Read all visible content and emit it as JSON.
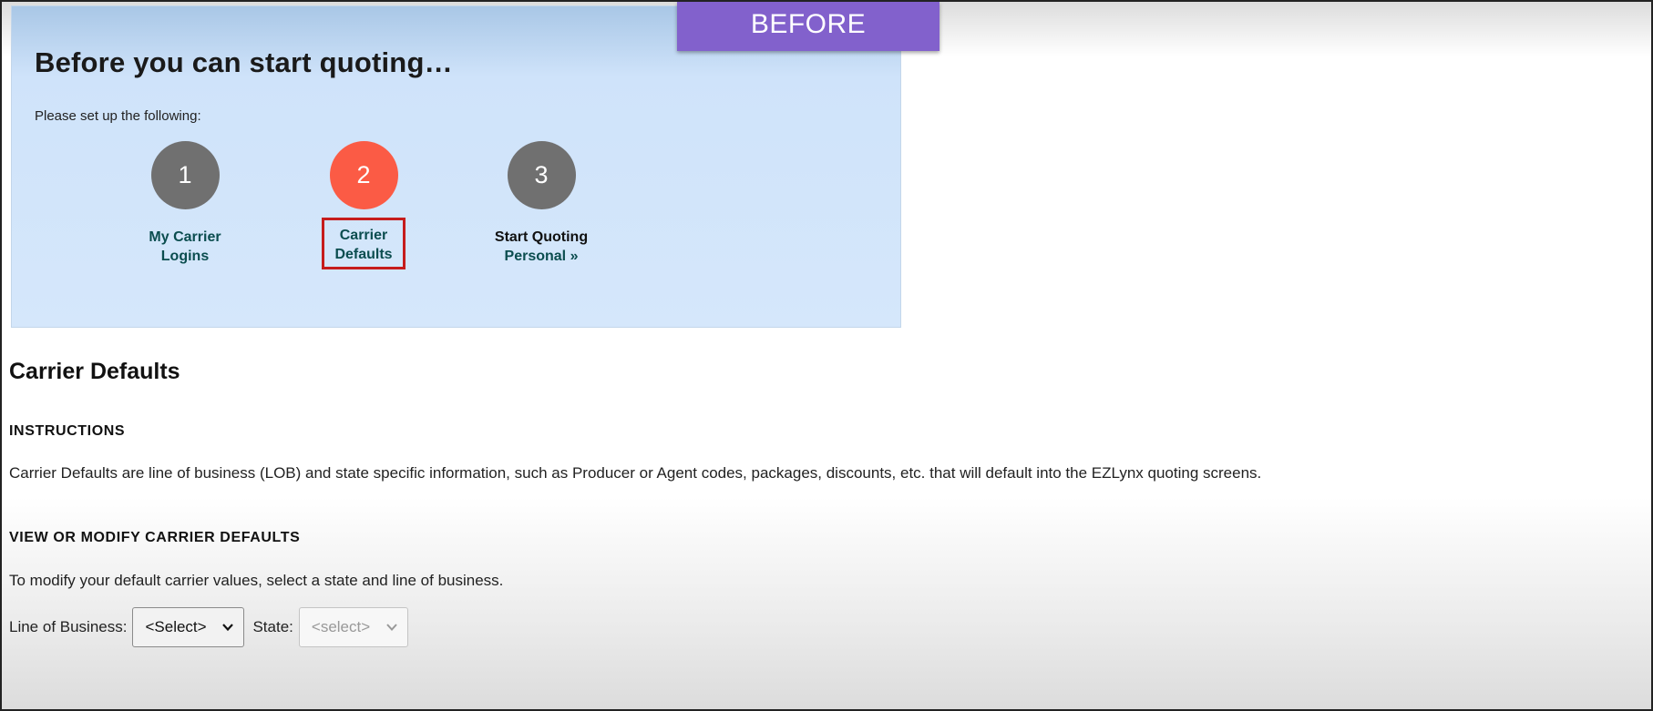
{
  "overlay": {
    "before_label": "BEFORE"
  },
  "setup": {
    "title": "Before you can start quoting…",
    "subtitle": "Please set up the following:",
    "steps": [
      {
        "number": "1",
        "line1": "My Carrier",
        "line2": "Logins",
        "state": "default"
      },
      {
        "number": "2",
        "line1": "Carrier",
        "line2": "Defaults",
        "state": "active"
      },
      {
        "number": "3",
        "line1": "Start Quoting",
        "line2": "Personal »",
        "state": "default"
      }
    ],
    "colors": {
      "inactive_circle": "#707070",
      "active_circle": "#fb5b45",
      "link": "#0b4d4f",
      "highlight_box": "#c61c1c"
    }
  },
  "page": {
    "title": "Carrier Defaults",
    "instructions_heading": "INSTRUCTIONS",
    "instructions_text": "Carrier Defaults are line of business (LOB) and state specific information, such as Producer or Agent codes, packages, discounts, etc. that will default into the EZLynx quoting screens.",
    "view_heading": "VIEW OR MODIFY CARRIER DEFAULTS",
    "view_text": "To modify your default carrier values, select a state and line of business.",
    "filters": {
      "lob_label": "Line of Business:",
      "lob_value": "<Select>",
      "state_label": "State:",
      "state_value": "<select>"
    }
  }
}
